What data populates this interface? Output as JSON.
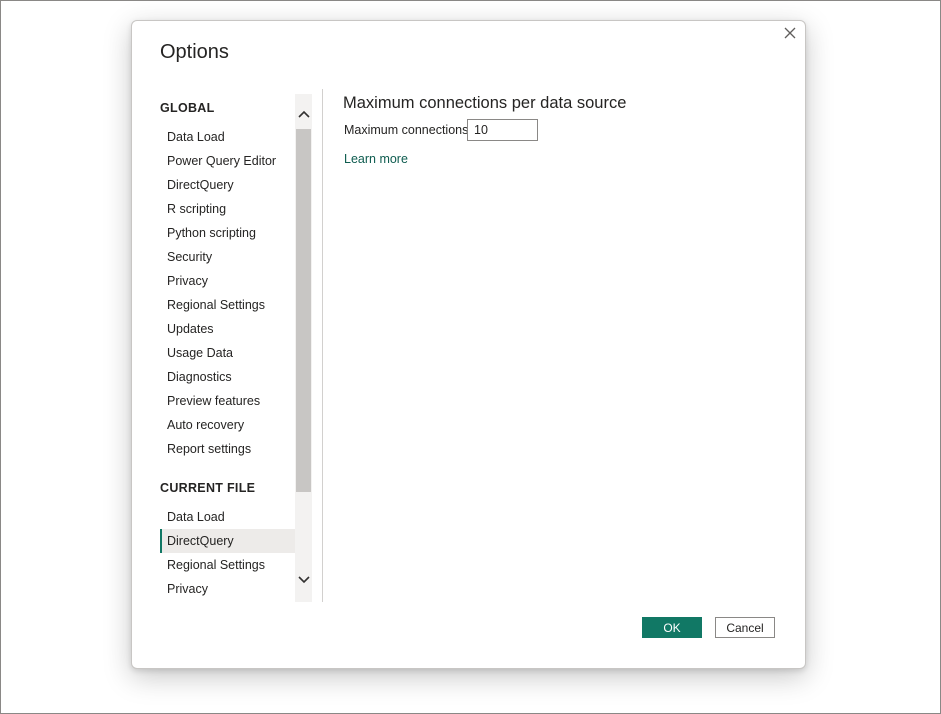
{
  "dialog": {
    "title": "Options",
    "close_icon": "close-icon"
  },
  "nav": {
    "global_heading": "GLOBAL",
    "global_items": [
      {
        "label": "Data Load"
      },
      {
        "label": "Power Query Editor"
      },
      {
        "label": "DirectQuery"
      },
      {
        "label": "R scripting"
      },
      {
        "label": "Python scripting"
      },
      {
        "label": "Security"
      },
      {
        "label": "Privacy"
      },
      {
        "label": "Regional Settings"
      },
      {
        "label": "Updates"
      },
      {
        "label": "Usage Data"
      },
      {
        "label": "Diagnostics"
      },
      {
        "label": "Preview features"
      },
      {
        "label": "Auto recovery"
      },
      {
        "label": "Report settings"
      }
    ],
    "current_file_heading": "CURRENT FILE",
    "current_file_items": [
      {
        "label": "Data Load"
      },
      {
        "label": "DirectQuery"
      },
      {
        "label": "Regional Settings"
      },
      {
        "label": "Privacy"
      }
    ],
    "selected_item": "DirectQuery"
  },
  "main": {
    "heading": "Maximum connections per data source",
    "field_label": "Maximum connections",
    "field_value": "10",
    "learn_more": "Learn more"
  },
  "footer": {
    "ok_label": "OK",
    "cancel_label": "Cancel"
  },
  "colors": {
    "accent": "#117865",
    "link": "#0e5c4f",
    "selected_bg": "#edebe9"
  }
}
